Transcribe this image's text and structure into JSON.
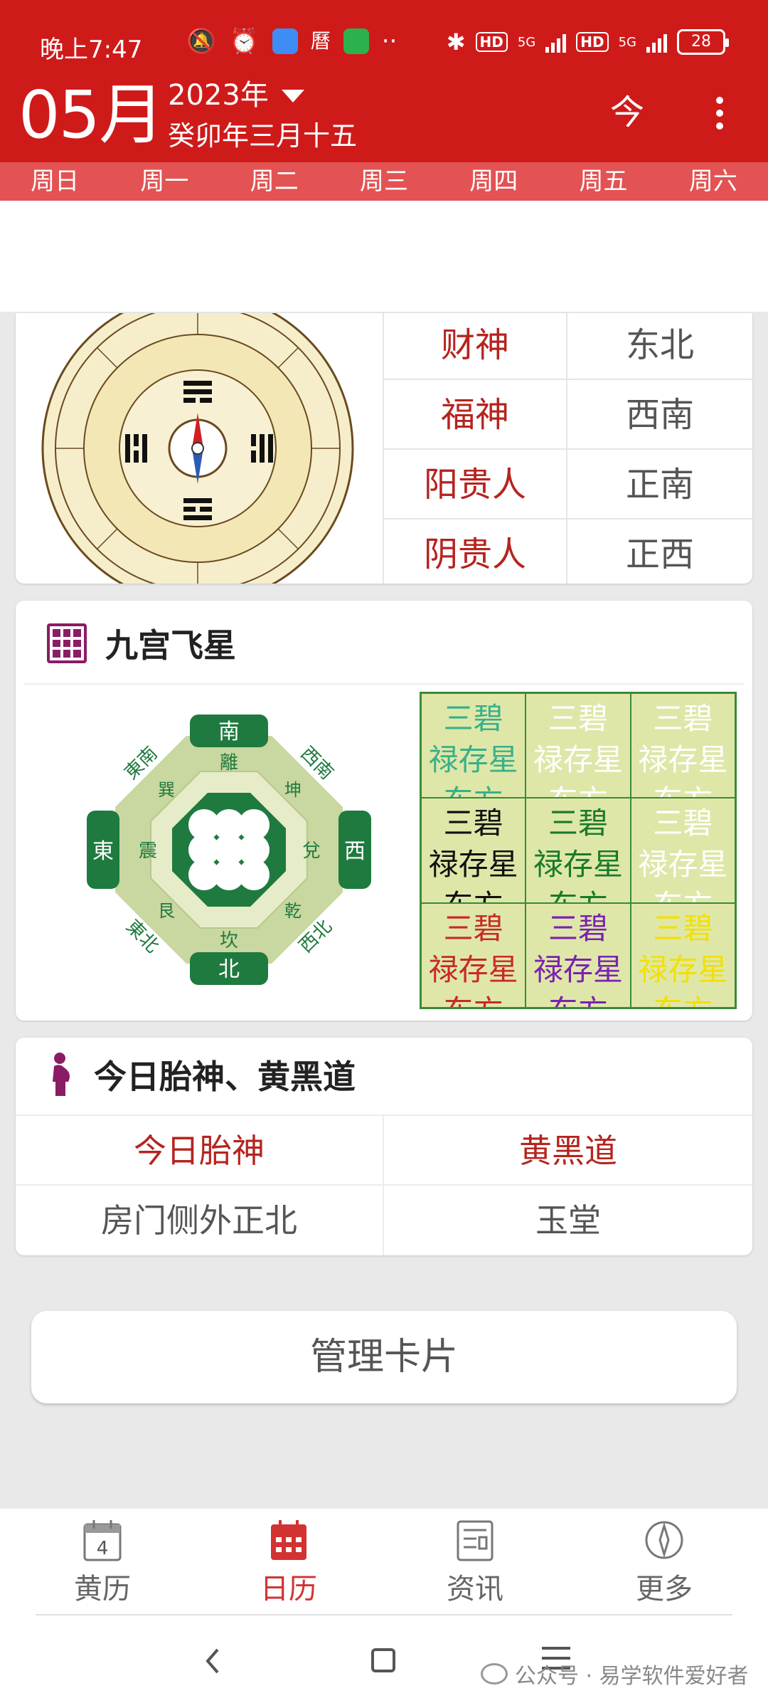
{
  "status": {
    "time": "晚上7:47",
    "hd1": "HD",
    "hd2": "HD",
    "net1": "5G",
    "net2": "5G",
    "battery": "28"
  },
  "header": {
    "month": "05月",
    "year": "2023年",
    "lunar": "癸卯年三月十五",
    "today_label": "今"
  },
  "weekdays": [
    "周日",
    "周一",
    "周二",
    "周三",
    "周四",
    "周五",
    "周六"
  ],
  "gods": [
    {
      "name": "财神",
      "dir": "东北"
    },
    {
      "name": "福神",
      "dir": "西南"
    },
    {
      "name": "阳贵人",
      "dir": "正南"
    },
    {
      "name": "阴贵人",
      "dir": "正西"
    }
  ],
  "stars_card": {
    "title": "九宫飞星",
    "bagua": {
      "south": "南",
      "north": "北",
      "east": "東",
      "west": "西",
      "southeast": "東南",
      "southwest": "西南",
      "northeast": "東北",
      "northwest": "西北",
      "li": "離",
      "kan": "坎",
      "zhen": "震",
      "dui": "兌",
      "xun": "巽",
      "kun": "坤",
      "gen": "艮",
      "qian": "乾"
    },
    "grid": [
      {
        "l1": "三碧",
        "l2": "禄存星",
        "l3": "东方",
        "color": "#38b08a"
      },
      {
        "l1": "三碧",
        "l2": "禄存星",
        "l3": "东方",
        "color": "#ffffff"
      },
      {
        "l1": "三碧",
        "l2": "禄存星",
        "l3": "东方",
        "color": "#ffffff"
      },
      {
        "l1": "三碧",
        "l2": "禄存星",
        "l3": "东方",
        "color": "#111111"
      },
      {
        "l1": "三碧",
        "l2": "禄存星",
        "l3": "东方",
        "color": "#1a7a2a"
      },
      {
        "l1": "三碧",
        "l2": "禄存星",
        "l3": "东方",
        "color": "#ffffff"
      },
      {
        "l1": "三碧",
        "l2": "禄存星",
        "l3": "东方",
        "color": "#c8282a"
      },
      {
        "l1": "三碧",
        "l2": "禄存星",
        "l3": "东方",
        "color": "#7a22b0"
      },
      {
        "l1": "三碧",
        "l2": "禄存星",
        "l3": "东方",
        "color": "#f2e000"
      }
    ]
  },
  "taishen_card": {
    "title": "今日胎神、黄黑道",
    "head_left": "今日胎神",
    "head_right": "黄黑道",
    "val_left": "房门侧外正北",
    "val_right": "玉堂"
  },
  "manage_button": "管理卡片",
  "nav": {
    "huangli": "黄历",
    "rili": "日历",
    "zixun": "资讯",
    "gengduo": "更多",
    "calendar_day": "4"
  },
  "watermark": "公众号 · 易学软件爱好者"
}
